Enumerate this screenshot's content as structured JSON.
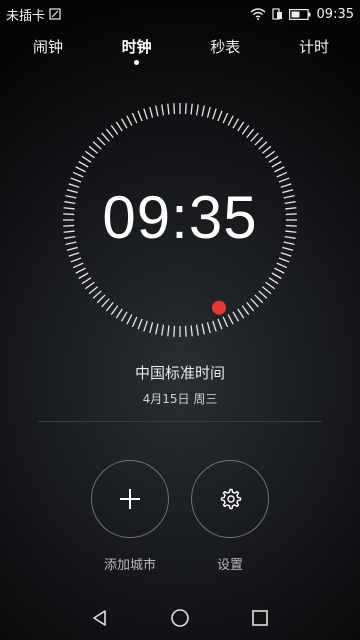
{
  "status_bar": {
    "carrier": "未插卡",
    "time": "09:35",
    "icons": [
      "sim-card-icon",
      "wifi-icon",
      "dual-sim-icon",
      "battery-icon"
    ]
  },
  "tabs": [
    {
      "label": "闹钟",
      "active": false
    },
    {
      "label": "时钟",
      "active": true
    },
    {
      "label": "秒表",
      "active": false
    },
    {
      "label": "计时",
      "active": false
    }
  ],
  "clock": {
    "time": "09:35",
    "timezone": "中国标准时间",
    "date": "4月15日 周三",
    "seconds_indicator_color": "#e53935"
  },
  "actions": {
    "add_city_label": "添加城市",
    "settings_label": "设置",
    "add_city_icon": "plus-icon",
    "settings_icon": "gear-icon"
  },
  "nav_bar": {
    "icons": [
      "back-triangle-icon",
      "home-circle-icon",
      "recents-square-icon"
    ]
  }
}
